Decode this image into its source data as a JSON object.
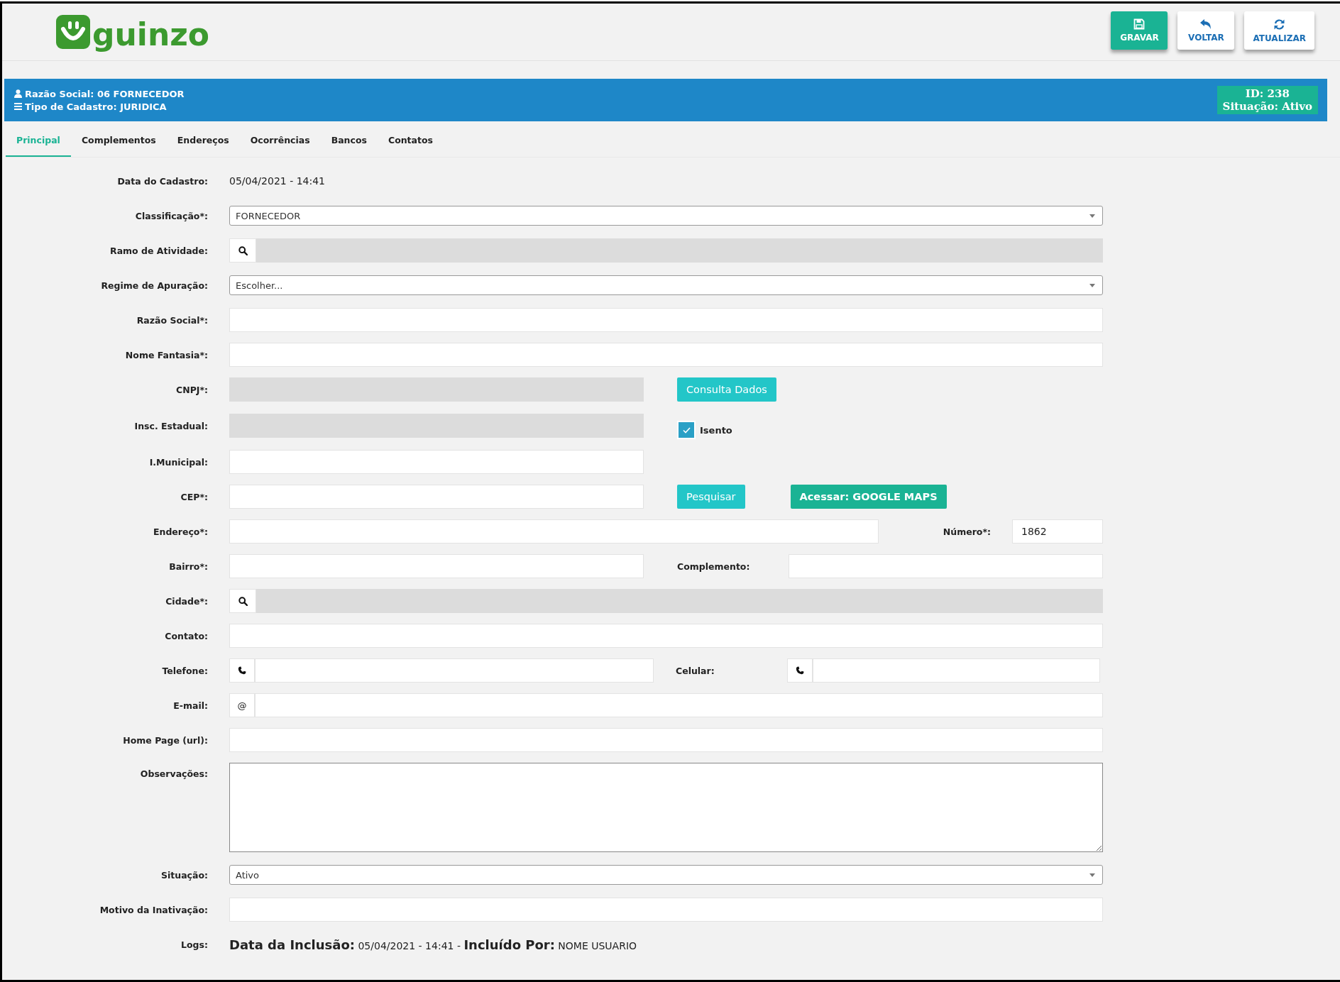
{
  "header": {
    "logo_text": "guinzo",
    "buttons": [
      {
        "label": "GRAVAR",
        "kind": "save"
      },
      {
        "label": "VOLTAR",
        "kind": "back"
      },
      {
        "label": "ATUALIZAR",
        "kind": "refresh"
      }
    ]
  },
  "info_bar": {
    "lines": [
      {
        "kind": "user",
        "text": "Razão Social: 06 FORNECEDOR"
      },
      {
        "kind": "list",
        "text": "Tipo de Cadastro: JURIDICA"
      }
    ],
    "badge": [
      "ID: 238",
      "Situação: Ativo"
    ]
  },
  "tabs": [
    {
      "label": "Principal",
      "selected": true
    },
    {
      "label": "Complementos",
      "selected": false
    },
    {
      "label": "Endereços",
      "selected": false
    },
    {
      "label": "Ocorrências",
      "selected": false
    },
    {
      "label": "Bancos",
      "selected": false
    },
    {
      "label": "Contatos",
      "selected": false
    }
  ],
  "rows": [
    {
      "label": "Data do Cadastro:",
      "kind": "text",
      "value": "05/04/2021 - 14:41"
    },
    {
      "label": "Classificação*:",
      "kind": "select",
      "value": "FORNECEDOR"
    },
    {
      "label": "Ramo de Atividade:",
      "kind": "lookup"
    },
    {
      "label": "Regime de Apuração:",
      "kind": "select",
      "value": "Escolher..."
    },
    {
      "label": "Razão Social*:",
      "kind": "input"
    },
    {
      "label": "Nome Fantasia*:",
      "kind": "input"
    },
    {
      "label": "CNPJ*:",
      "kind": "half",
      "disabled": true,
      "buttons": [
        {
          "label": "Consulta Dados",
          "kind": "query"
        }
      ]
    },
    {
      "label": "Insc. Estadual:",
      "kind": "half",
      "disabled": true,
      "checkbox": {
        "label": "Isento",
        "checked": true
      }
    },
    {
      "label": "I.Municipal:",
      "kind": "half",
      "disabled": false
    },
    {
      "label": "CEP*:",
      "kind": "half",
      "disabled": false,
      "buttons": [
        {
          "label": "Pesquisar",
          "kind": "search"
        },
        {
          "label": "Acessar: GOOGLE MAPS",
          "kind": "map"
        }
      ]
    },
    {
      "label": "Endereço*:",
      "kind": "address",
      "second": {
        "label": "Número*:",
        "value": "1862"
      }
    },
    {
      "label": "Bairro*:",
      "kind": "pair",
      "second": {
        "label": "Complemento:"
      }
    },
    {
      "label": "Cidade*:",
      "kind": "lookup"
    },
    {
      "label": "Contato:",
      "kind": "input"
    },
    {
      "label": "Telefone:",
      "kind": "phone_pair",
      "second": {
        "label": "Celular:"
      }
    },
    {
      "label": "E-mail:",
      "kind": "email",
      "prefix": "@"
    },
    {
      "label": "Home Page (url):",
      "kind": "input"
    },
    {
      "label": "Observações:",
      "kind": "textarea"
    },
    {
      "label": "Situação:",
      "kind": "select",
      "value": "Ativo"
    },
    {
      "label": "Motivo da Inativação:",
      "kind": "input"
    },
    {
      "label": "Logs:",
      "kind": "logs",
      "value": "**Data da Inclusão:** 05/04/2021 - 14:41 - **Incluído Por:** NOME USUARIO"
    }
  ]
}
